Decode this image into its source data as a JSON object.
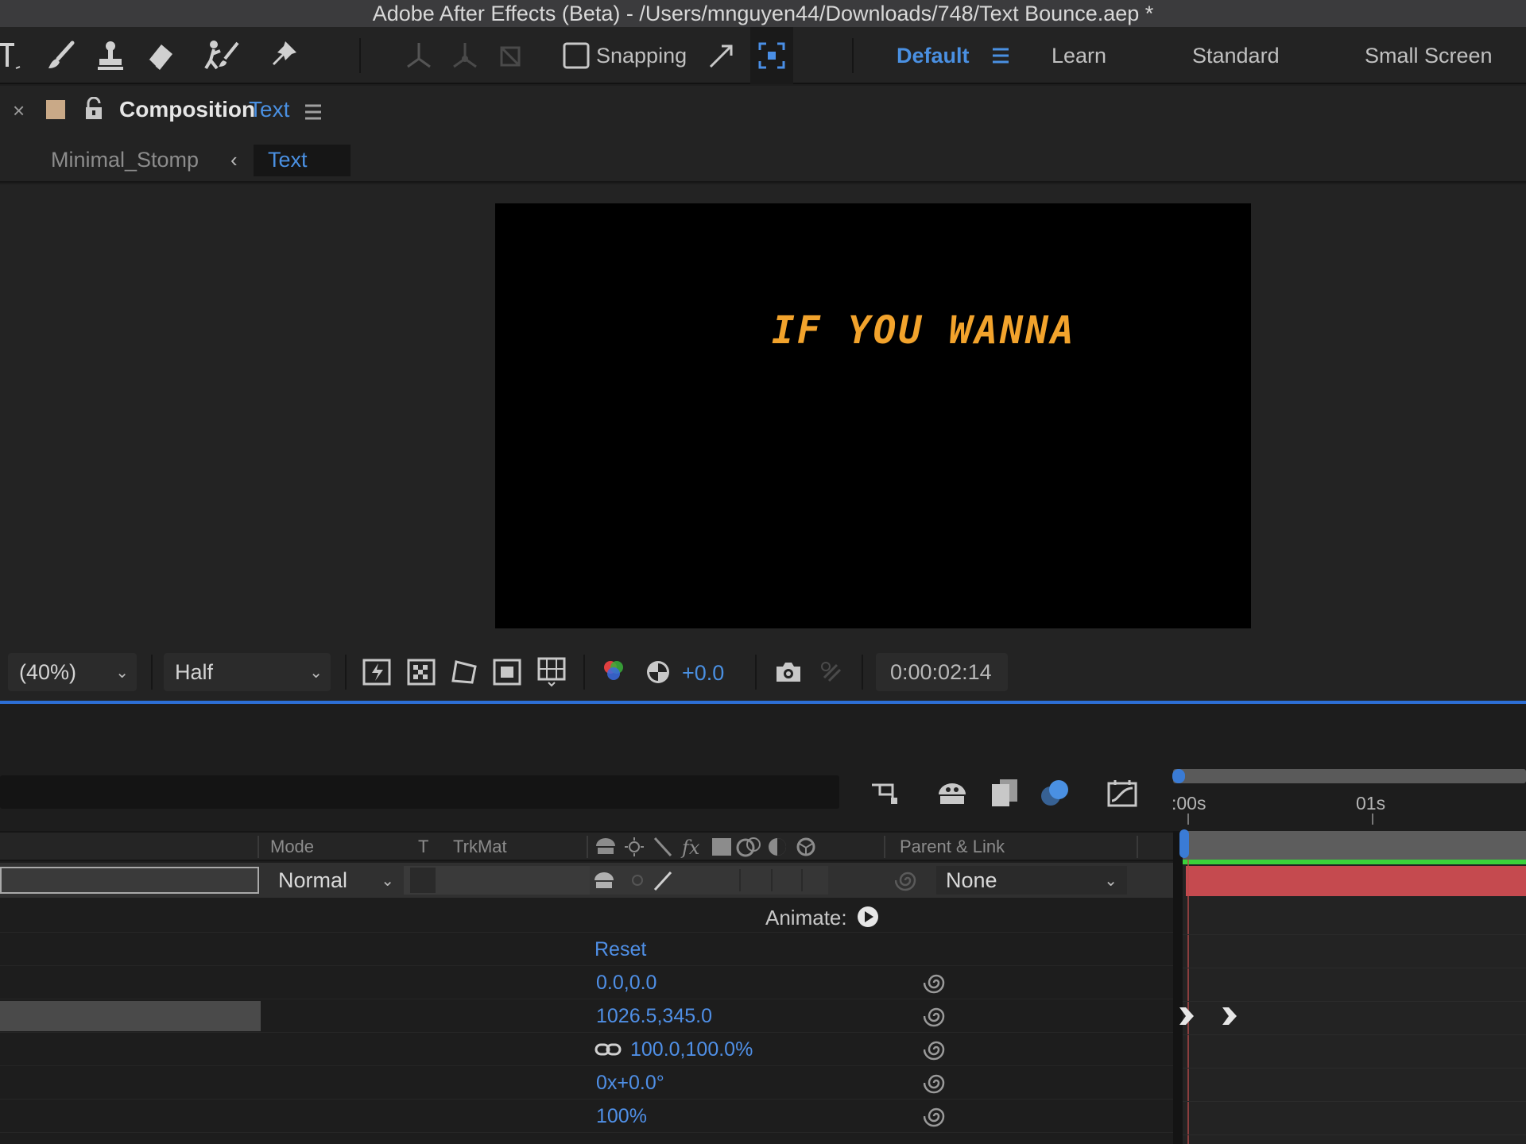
{
  "title_bar": {
    "text": "Adobe After Effects (Beta) - /Users/mnguyen44/Downloads/748/Text Bounce.aep *"
  },
  "toolbar": {
    "snapping_label": "Snapping",
    "workspaces": [
      "Default",
      "Learn",
      "Standard",
      "Small Screen"
    ],
    "active_workspace": "Default",
    "accent_color": "#4a90e2"
  },
  "composition_panel": {
    "tab_label": "Composition",
    "comp_name": "Text",
    "breadcrumb_parent": "Minimal_Stomp",
    "breadcrumb_current": "Text",
    "swatch_color": "#c9a987"
  },
  "viewer": {
    "canvas_text": "IF YOU WANNA",
    "canvas_text_color": "#f2a32c",
    "zoom": "(40%)",
    "resolution": "Half",
    "exposure": "+0.0",
    "timecode": "0:00:02:14"
  },
  "timeline": {
    "ruler_labels": [
      ":00s",
      "01s"
    ],
    "columns": {
      "mode": "Mode",
      "t": "T",
      "trkmat": "TrkMat",
      "parent": "Parent & Link"
    },
    "layer": {
      "mode": "Normal",
      "parent": "None",
      "bar_color": "#c54a4f"
    },
    "animate_label": "Animate:",
    "reset_label": "Reset",
    "properties": [
      {
        "value": "0.0,0.0",
        "link_icon": false
      },
      {
        "value": "1026.5,345.0",
        "link_icon": false
      },
      {
        "value": "100.0,100.0%",
        "link_icon": true
      },
      {
        "value": "0x+0.0°",
        "link_icon": false
      },
      {
        "value": "100%",
        "link_icon": false
      }
    ]
  }
}
